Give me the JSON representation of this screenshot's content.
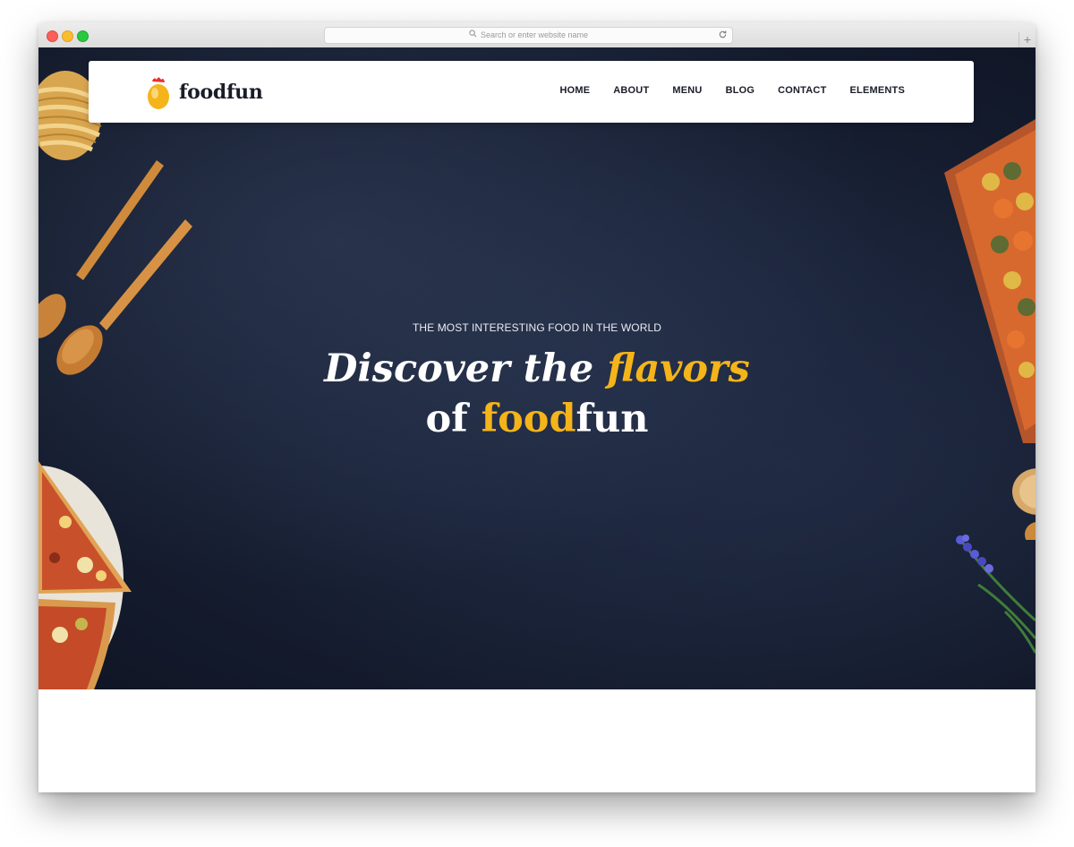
{
  "browser": {
    "address_placeholder": "Search or enter website name",
    "new_tab_label": "+"
  },
  "site": {
    "brand": "foodfun",
    "nav": [
      {
        "label": "HOME"
      },
      {
        "label": "ABOUT"
      },
      {
        "label": "MENU"
      },
      {
        "label": "BLOG"
      },
      {
        "label": "CONTACT"
      },
      {
        "label": "ELEMENTS"
      }
    ]
  },
  "hero": {
    "eyebrow": "THE MOST INTERESTING FOOD IN THE WORLD",
    "line1_part1": "Discover the ",
    "line1_highlight": "flavors",
    "line2_part1": "of ",
    "line2_highlight": "food",
    "line2_part2": "fun"
  },
  "colors": {
    "accent": "#f4b41a",
    "hero_bg": "#141b2d",
    "nav_text": "#1a1c28"
  }
}
